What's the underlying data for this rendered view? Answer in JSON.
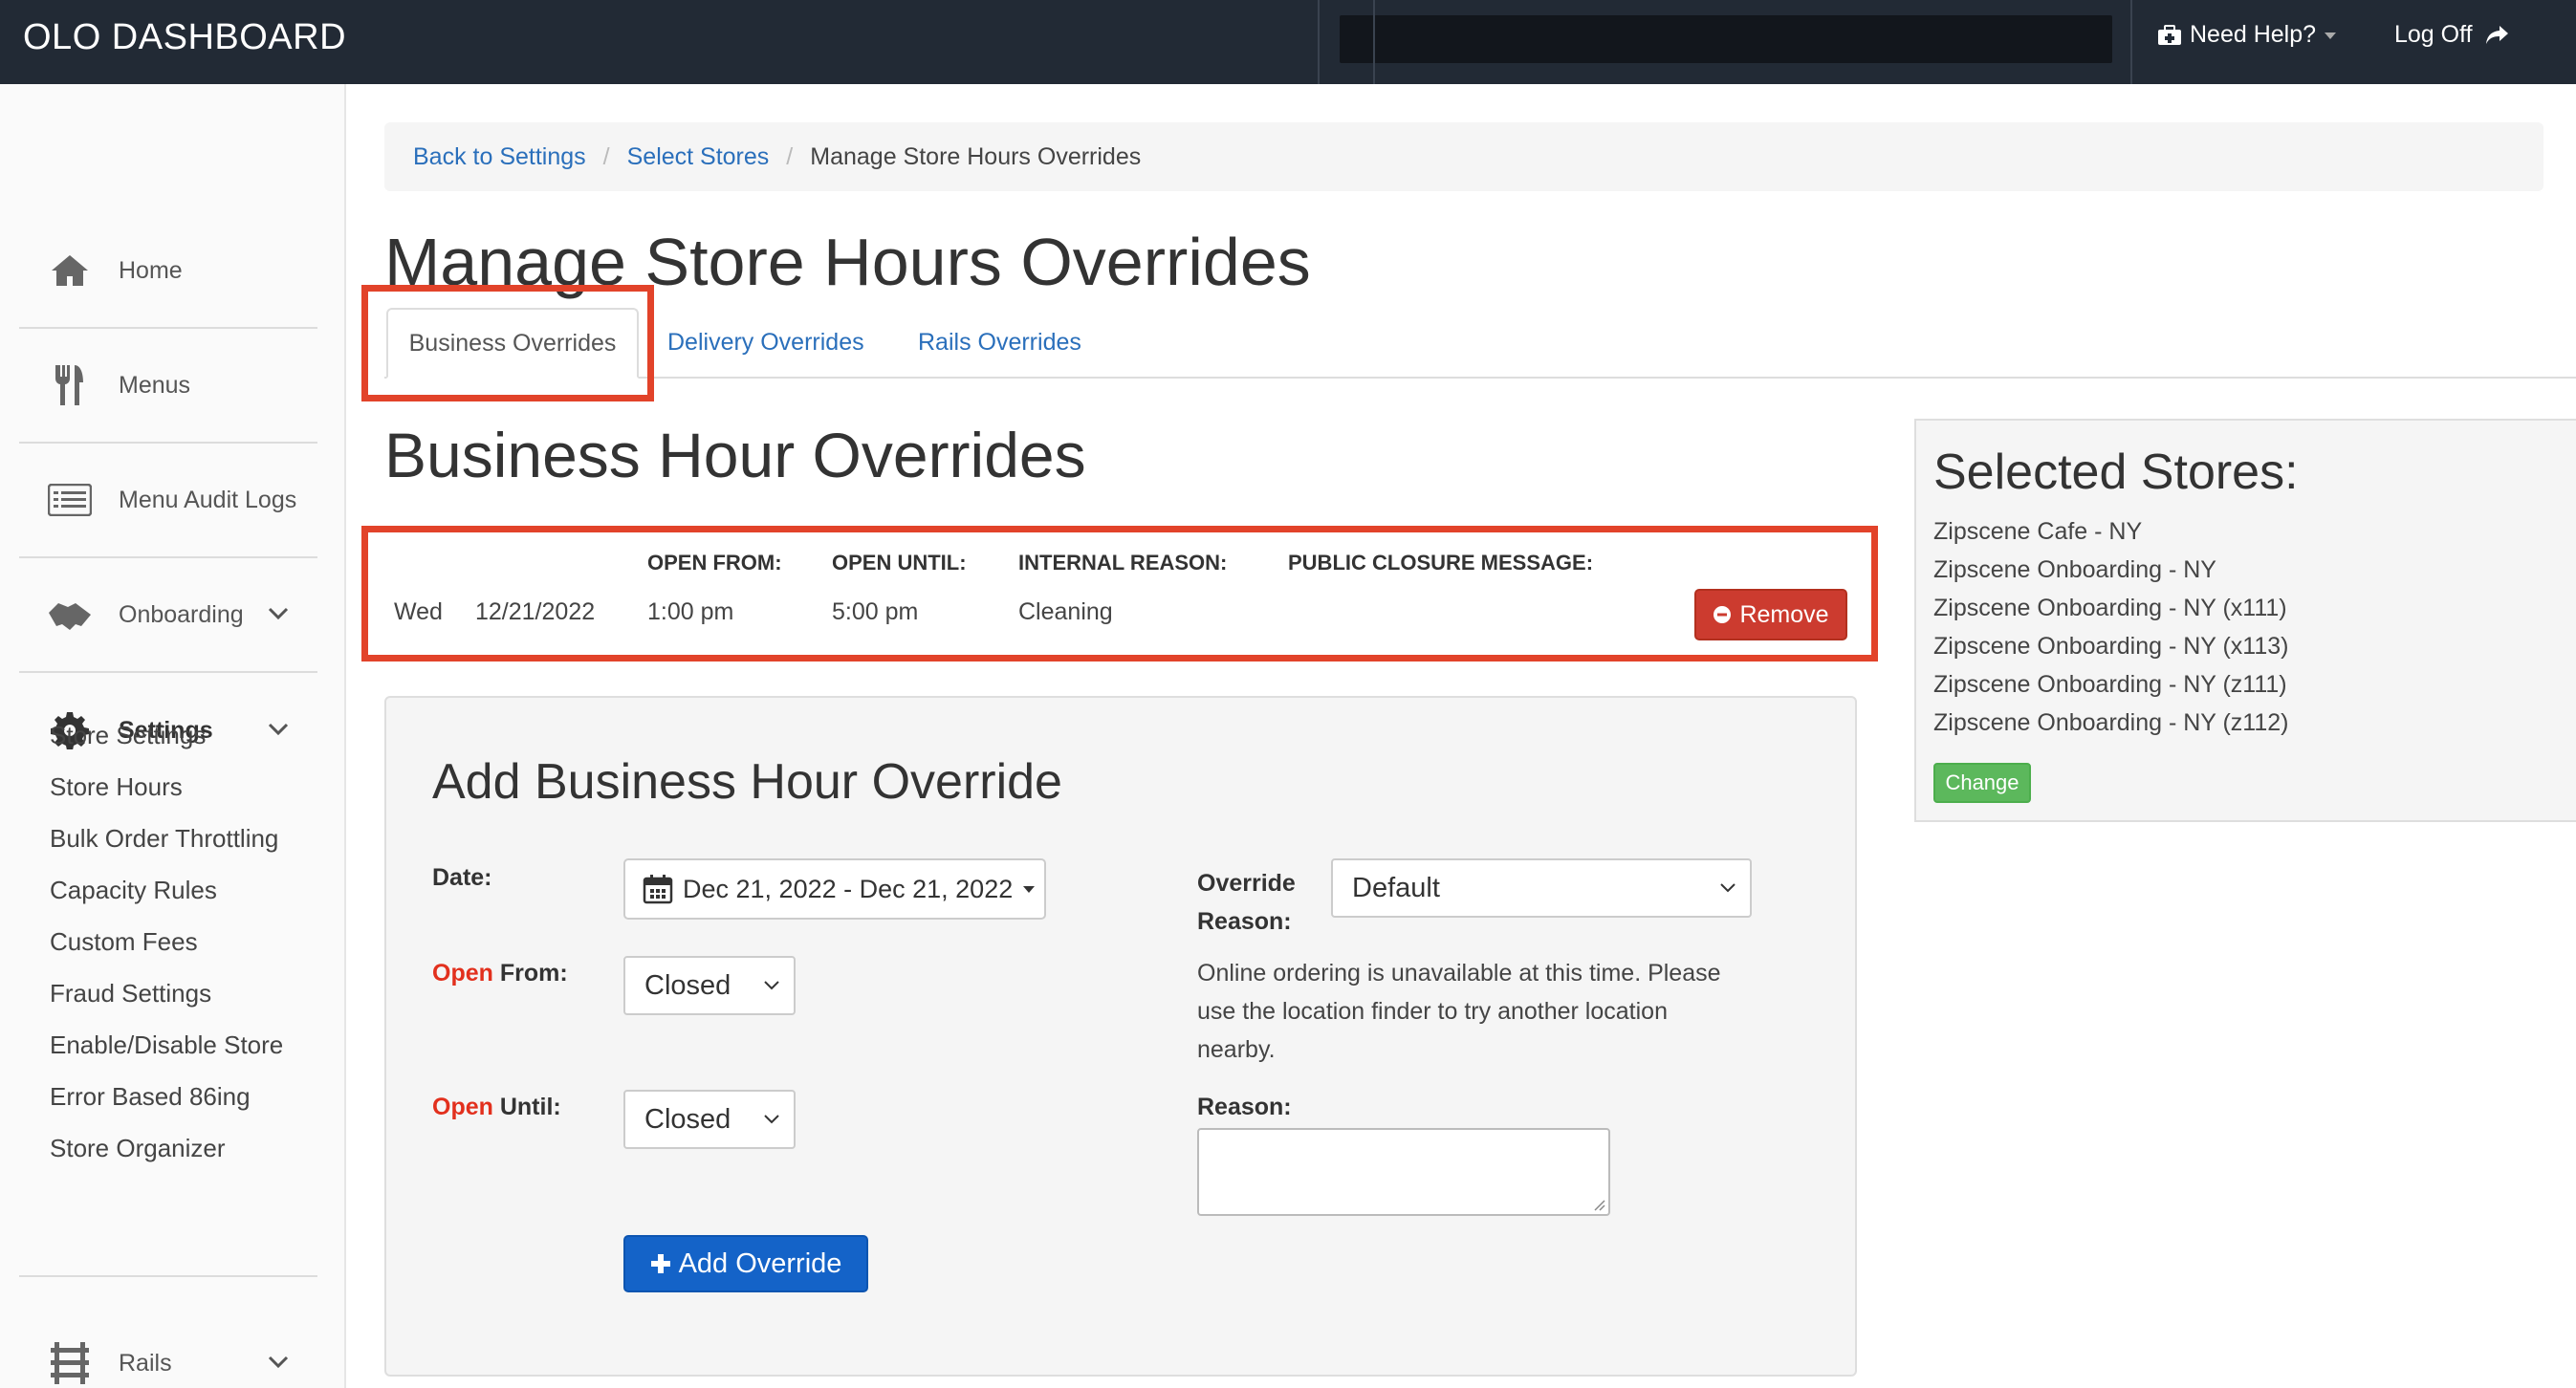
{
  "header": {
    "brand": "OLO DASHBOARD",
    "help_label": "Need Help?",
    "logoff_label": "Log Off"
  },
  "sidebar": {
    "items": [
      {
        "label": "Home",
        "icon": "home-icon"
      },
      {
        "label": "Menus",
        "icon": "utensils-icon"
      },
      {
        "label": "Menu Audit Logs",
        "icon": "list-icon"
      },
      {
        "label": "Onboarding",
        "icon": "handshake-icon"
      },
      {
        "label": "Settings",
        "icon": "gear-icon"
      },
      {
        "label": "Rails",
        "icon": "rails-icon"
      }
    ],
    "settings_subitems": [
      "Store Settings",
      "Store Hours",
      "Bulk Order Throttling",
      "Capacity Rules",
      "Custom Fees",
      "Fraud Settings",
      "Enable/Disable Store",
      "Error Based 86ing",
      "Store Organizer"
    ]
  },
  "breadcrumb": {
    "items": [
      "Back to Settings",
      "Select Stores"
    ],
    "current": "Manage Store Hours Overrides"
  },
  "page_title": "Manage Store Hours Overrides",
  "tabs": [
    {
      "label": "Business Overrides",
      "active": true
    },
    {
      "label": "Delivery Overrides",
      "active": false
    },
    {
      "label": "Rails Overrides",
      "active": false
    }
  ],
  "section_title": "Business Hour Overrides",
  "overrides_table": {
    "headers": [
      "OPEN FROM:",
      "OPEN UNTIL:",
      "INTERNAL REASON:",
      "PUBLIC CLOSURE MESSAGE:"
    ],
    "rows": [
      {
        "day": "Wed",
        "date": "12/21/2022",
        "open_from": "1:00 pm",
        "open_until": "5:00 pm",
        "internal_reason": "Cleaning",
        "public_message": ""
      }
    ],
    "remove_label": "Remove"
  },
  "add_form": {
    "title": "Add Business Hour Override",
    "date_label": "Date:",
    "date_value": "Dec 21, 2022 - Dec 21, 2022",
    "open_from_prefix": "Open",
    "open_from_suffix": " From:",
    "open_from_value": "Closed",
    "open_until_prefix": "Open",
    "open_until_suffix": " Until:",
    "open_until_value": "Closed",
    "override_reason_label_1": "Override",
    "override_reason_label_2": "Reason:",
    "override_reason_value": "Default",
    "info_text": "Online ordering is unavailable at this time. Please use the location finder to try another location nearby.",
    "reason_label": "Reason:",
    "reason_value": "",
    "add_button_label": "Add Override"
  },
  "selected_stores": {
    "title": "Selected Stores:",
    "stores": [
      "Zipscene Cafe - NY",
      "Zipscene Onboarding - NY",
      "Zipscene Onboarding - NY (x111)",
      "Zipscene Onboarding - NY (x113)",
      "Zipscene Onboarding - NY (z111)",
      "Zipscene Onboarding - NY (z112)"
    ],
    "change_label": "Change"
  },
  "colors": {
    "topbar": "#222a35",
    "link": "#2a6fbb",
    "highlight": "#e2432a",
    "remove": "#cc3b2f",
    "add": "#1463c8",
    "change": "#5cb85c"
  }
}
